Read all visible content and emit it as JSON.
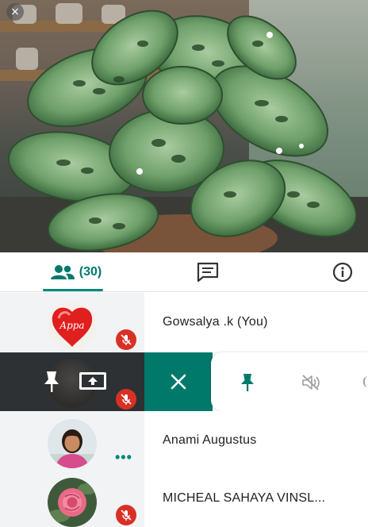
{
  "video": {
    "close_icon": "close-icon",
    "close_glyph": "×"
  },
  "tabs": {
    "people_count": "(30)",
    "people_icon": "people-icon",
    "chat_icon": "chat-icon",
    "info_icon": "info-icon"
  },
  "participants": [
    {
      "name": "Gowsalya .k (You)",
      "avatar_text": "Appa",
      "muted": true
    },
    {
      "name": "",
      "muted": true
    },
    {
      "name": "Anami Augustus",
      "muted": false,
      "more": "•••"
    },
    {
      "name": "MICHEAL SAHAYA VINSL...",
      "muted": true
    }
  ],
  "actions": {
    "close_glyph": "✕",
    "pin_icon": "pin-icon",
    "mute_icon": "mic-off-icon",
    "present_icon": "present-icon"
  },
  "colors": {
    "accent": "#00796b",
    "accent_light": "#00897b",
    "mute_red": "#d93025",
    "dark_row": "#2d3134"
  }
}
